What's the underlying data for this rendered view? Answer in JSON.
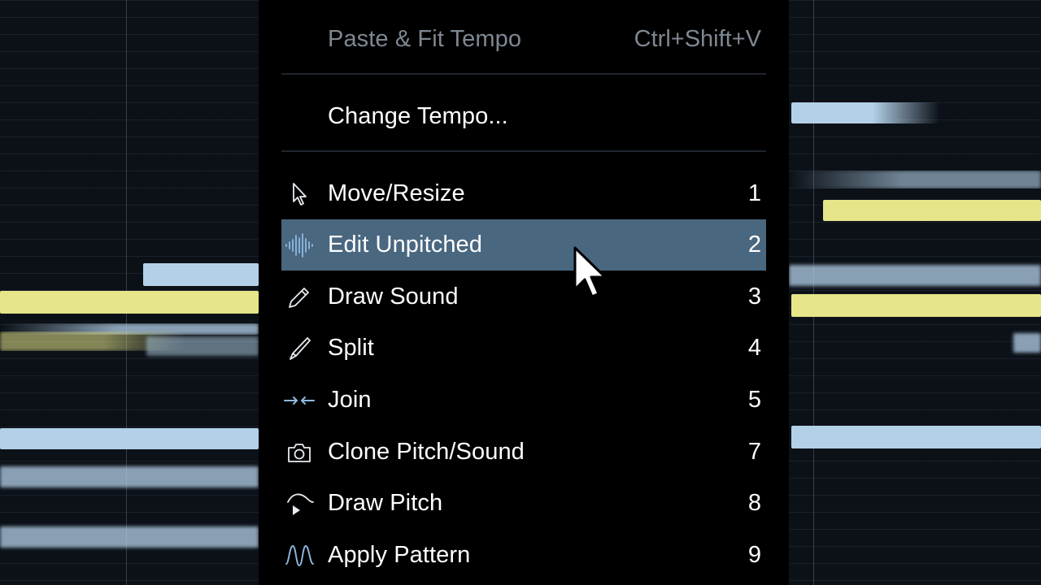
{
  "menu": {
    "header_items": [
      {
        "label": "Paste & Fit Tempo",
        "shortcut": "Ctrl+Shift+V",
        "enabled": false
      },
      {
        "label": "Change Tempo...",
        "shortcut": "",
        "enabled": true
      }
    ],
    "tools": [
      {
        "label": "Move/Resize",
        "shortcut": "1",
        "icon": "pointer-icon",
        "highlighted": false
      },
      {
        "label": "Edit Unpitched",
        "shortcut": "2",
        "icon": "waveform-icon",
        "highlighted": true
      },
      {
        "label": "Draw Sound",
        "shortcut": "3",
        "icon": "pencil-icon",
        "highlighted": false
      },
      {
        "label": "Split",
        "shortcut": "4",
        "icon": "blade-icon",
        "highlighted": false
      },
      {
        "label": "Join",
        "shortcut": "5",
        "icon": "join-icon",
        "highlighted": false
      },
      {
        "label": "Clone Pitch/Sound",
        "shortcut": "7",
        "icon": "camera-icon",
        "highlighted": false
      },
      {
        "label": "Draw Pitch",
        "shortcut": "8",
        "icon": "pitch-curve-icon",
        "highlighted": false
      },
      {
        "label": "Apply Pattern",
        "shortcut": "9",
        "icon": "pattern-wave-icon",
        "highlighted": false
      }
    ]
  },
  "colors": {
    "menu_background": "#000000",
    "highlight": "#4a6780",
    "disabled_text": "#7e8892",
    "icon_blue": "#8fb8e0",
    "note_blue": "#b3d0e8",
    "note_yellow": "#e6e589"
  }
}
